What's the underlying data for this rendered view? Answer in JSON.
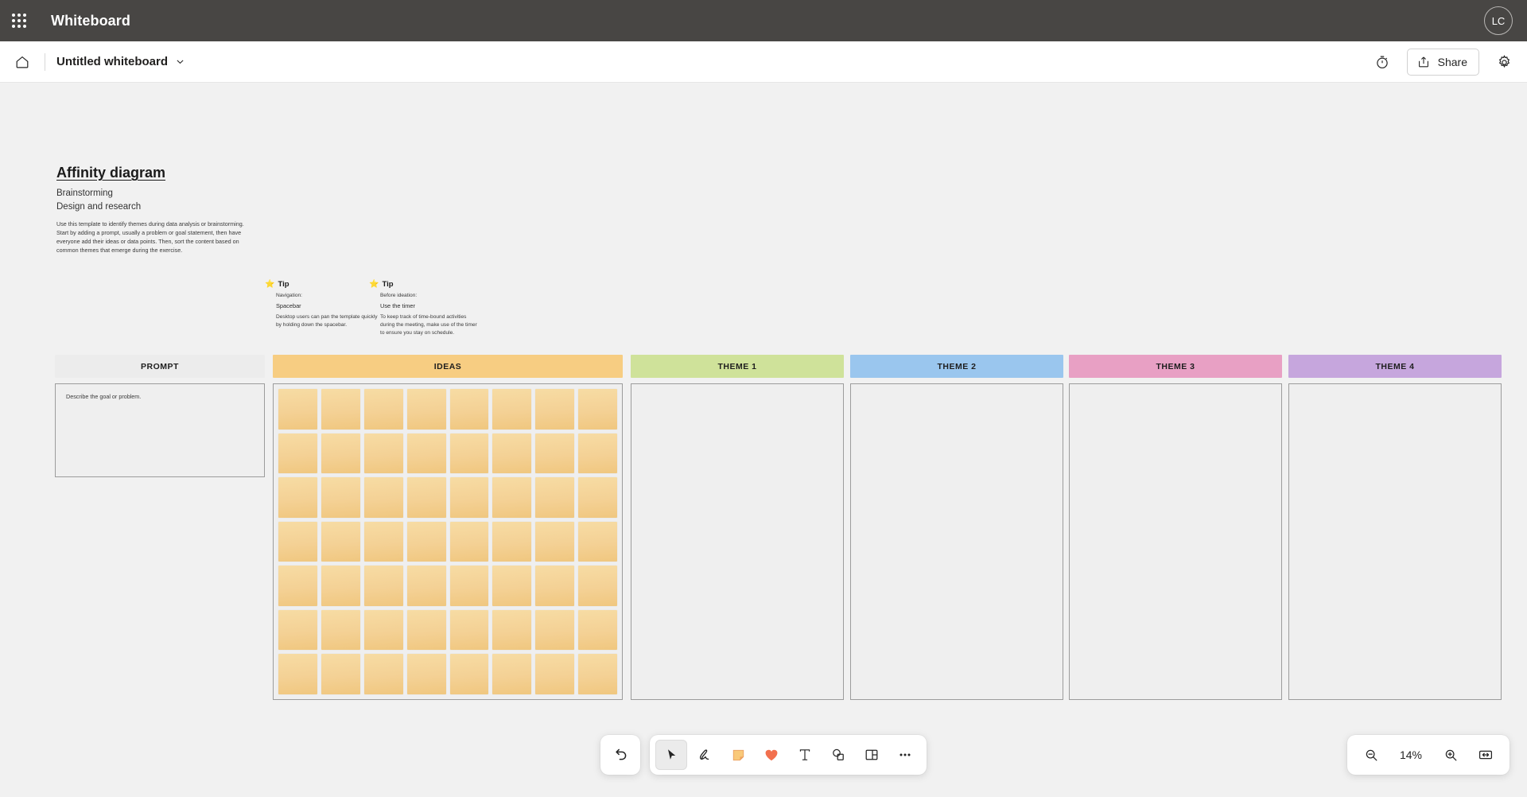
{
  "appbar": {
    "waffle_icon": "app-launcher-icon",
    "title": "Whiteboard",
    "avatar_initials": "LC"
  },
  "commandbar": {
    "home_icon": "home-icon",
    "document_title": "Untitled whiteboard",
    "chevron_icon": "chevron-down-icon",
    "timer_icon": "timer-icon",
    "share_icon": "share-icon",
    "share_label": "Share",
    "settings_icon": "gear-icon"
  },
  "template": {
    "title": "Affinity diagram",
    "subtitle_1": "Brainstorming",
    "subtitle_2": "Design and research",
    "description": "Use this template to identify themes during data analysis or brainstorming. Start by adding a prompt, usually a problem or goal statement, then have everyone add their ideas or data points. Then, sort the content based on common themes that emerge during the exercise."
  },
  "tips": [
    {
      "icon": "star-icon",
      "title": "Tip",
      "label": "Navigation:",
      "keyword": "Spacebar",
      "body": "Desktop users can pan the template quickly by holding down the spacebar."
    },
    {
      "icon": "star-icon",
      "title": "Tip",
      "label": "Before ideation:",
      "keyword": "Use the timer",
      "body": "To keep track of time-bound activities during the meeting, make use of the timer to ensure you stay on schedule."
    }
  ],
  "board": {
    "columns": [
      {
        "label": "PROMPT",
        "header_color": "#ececec",
        "type": "prompt",
        "placeholder": "Describe the goal or problem."
      },
      {
        "label": "IDEAS",
        "header_color": "#f7cd82",
        "type": "ideas",
        "note_columns": 8,
        "note_rows": 7,
        "note_count": 56,
        "note_color": "#f4d195"
      },
      {
        "label": "THEME 1",
        "header_color": "#cfe29a",
        "type": "theme"
      },
      {
        "label": "THEME 2",
        "header_color": "#9ac6ee",
        "type": "theme"
      },
      {
        "label": "THEME 3",
        "header_color": "#e8a0c4",
        "type": "theme"
      },
      {
        "label": "THEME 4",
        "header_color": "#c6a6dd",
        "type": "theme"
      }
    ]
  },
  "toolbar": {
    "undo_icon": "undo-icon",
    "tools": [
      {
        "icon": "select-cursor-icon",
        "label": "Select",
        "active": true
      },
      {
        "icon": "pen-icon",
        "label": "Ink",
        "active": false
      },
      {
        "icon": "sticky-note-icon",
        "label": "Note",
        "active": false
      },
      {
        "icon": "heart-reaction-icon",
        "label": "Reaction",
        "active": false
      },
      {
        "icon": "text-icon",
        "label": "Text",
        "active": false
      },
      {
        "icon": "shapes-icon",
        "label": "Shapes",
        "active": false
      },
      {
        "icon": "templates-icon",
        "label": "Templates",
        "active": false
      },
      {
        "icon": "more-ellipsis-icon",
        "label": "More",
        "active": false
      }
    ]
  },
  "zoom_controls": {
    "zoom_out_icon": "zoom-out-icon",
    "level": "14%",
    "zoom_in_icon": "zoom-in-icon",
    "fit_icon": "fit-to-screen-icon"
  }
}
